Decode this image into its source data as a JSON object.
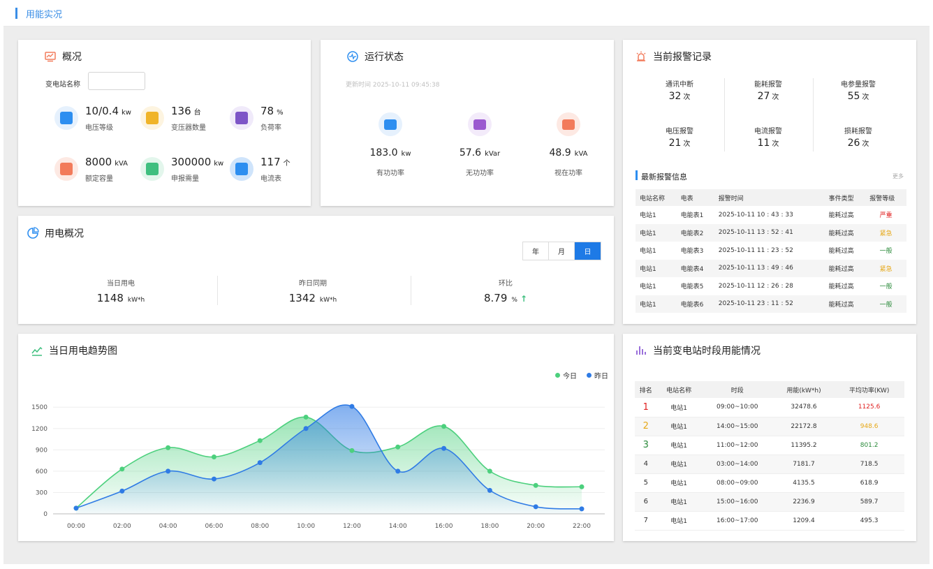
{
  "header": {
    "title": "用能实况"
  },
  "overview": {
    "title": "概况",
    "station_label": "变电站名称",
    "station_value": "",
    "metrics": [
      {
        "value": "10/0.4",
        "unit": "kw",
        "label": "电压等级",
        "icon": "gauge-icon",
        "color": "#2d8ef0",
        "bg": "#e6f1fd"
      },
      {
        "value": "136",
        "unit": "台",
        "label": "变压器数量",
        "icon": "transformer-icon",
        "color": "#f0b429",
        "bg": "#fdf4e0"
      },
      {
        "value": "78",
        "unit": "%",
        "label": "负荷率",
        "icon": "load-chart-icon",
        "color": "#7d55c7",
        "bg": "#f0eafa"
      },
      {
        "value": "8000",
        "unit": "kVA",
        "label": "额定容量",
        "icon": "capacity-icon",
        "color": "#f27b5b",
        "bg": "#fde9e3"
      },
      {
        "value": "300000",
        "unit": "kw",
        "label": "申报需量",
        "icon": "document-icon",
        "color": "#3fbf7f",
        "bg": "#e3f6ec"
      },
      {
        "value": "117",
        "unit": "个",
        "label": "电流表",
        "icon": "ammeter-icon",
        "color": "#2d8ef0",
        "bg": "#cfe4fb"
      }
    ]
  },
  "running": {
    "title": "运行状态",
    "update_time": "更新时间 2025-10-11 09:45:38",
    "items": [
      {
        "value": "183.0",
        "unit": "kw",
        "label": "有功功率",
        "icon": "wave-icon",
        "color": "#2d8ef0",
        "bg": "#e6f1fd"
      },
      {
        "value": "57.6",
        "unit": "kVar",
        "label": "无功功率",
        "icon": "q-icon",
        "color": "#9b59d0",
        "bg": "#f3ebfa"
      },
      {
        "value": "48.9",
        "unit": "kVA",
        "label": "视在功率",
        "icon": "bar-icon",
        "color": "#f27b5b",
        "bg": "#fde9e3"
      }
    ]
  },
  "alarm": {
    "title": "当前报警记录",
    "stats": [
      {
        "label": "通讯中断",
        "value": "32",
        "unit": "次"
      },
      {
        "label": "能耗报警",
        "value": "27",
        "unit": "次"
      },
      {
        "label": "电参量报警",
        "value": "55",
        "unit": "次"
      },
      {
        "label": "电压报警",
        "value": "21",
        "unit": "次"
      },
      {
        "label": "电流报警",
        "value": "11",
        "unit": "次"
      },
      {
        "label": "损耗报警",
        "value": "26",
        "unit": "次"
      }
    ],
    "latest_title": "最新报警信息",
    "more": "更多",
    "columns": [
      "电站名称",
      "电表",
      "报警时间",
      "事件类型",
      "报警等级"
    ],
    "rows": [
      {
        "station": "电站1",
        "meter": "电能表1",
        "time": "2025-10-11 10 : 43 : 33",
        "type": "能耗过高",
        "level": "严重",
        "color": "#e02020"
      },
      {
        "station": "电站1",
        "meter": "电能表2",
        "time": "2025-10-11 13 : 52 : 41",
        "type": "能耗过高",
        "level": "紧急",
        "color": "#e6a817"
      },
      {
        "station": "电站1",
        "meter": "电能表3",
        "time": "2025-10-11 11 : 23 : 52",
        "type": "能耗过高",
        "level": "一般",
        "color": "#2a8a3a"
      },
      {
        "station": "电站1",
        "meter": "电能表4",
        "time": "2025-10-11 13 : 49 : 46",
        "type": "能耗过高",
        "level": "紧急",
        "color": "#e6a817"
      },
      {
        "station": "电站1",
        "meter": "电能表5",
        "time": "2025-10-11 12 : 26 : 28",
        "type": "能耗过高",
        "level": "一般",
        "color": "#2a8a3a"
      },
      {
        "station": "电站1",
        "meter": "电能表6",
        "time": "2025-10-11 23 : 11 : 52",
        "type": "能耗过高",
        "level": "一般",
        "color": "#2a8a3a"
      }
    ]
  },
  "usage": {
    "title": "用电概况",
    "tabs": [
      "年",
      "月",
      "日"
    ],
    "active_tab": 2,
    "items": [
      {
        "label": "当日用电",
        "value": "1148",
        "unit": "kW*h"
      },
      {
        "label": "昨日同期",
        "value": "1342",
        "unit": "kW*h"
      },
      {
        "label": "环比",
        "value": "8.79",
        "unit": "%",
        "trend": "↑"
      }
    ]
  },
  "trend": {
    "title": "当日用电趋势图",
    "legend": [
      {
        "name": "今日",
        "color": "#4cd07d"
      },
      {
        "name": "昨日",
        "color": "#2f7be5"
      }
    ]
  },
  "chart_data": {
    "type": "area",
    "x": [
      "00:00",
      "02:00",
      "04:00",
      "06:00",
      "08:00",
      "10:00",
      "12:00",
      "14:00",
      "16:00",
      "18:00",
      "20:00",
      "22:00"
    ],
    "yticks": [
      0,
      300,
      600,
      900,
      1200,
      1500
    ],
    "ylim": [
      0,
      1600
    ],
    "grid": true,
    "legend_position": "top-right",
    "series": [
      {
        "name": "今日",
        "color": "#4cd07d",
        "values": [
          80,
          630,
          930,
          800,
          1030,
          1360,
          890,
          940,
          1230,
          600,
          400,
          380
        ]
      },
      {
        "name": "昨日",
        "color": "#2f7be5",
        "values": [
          80,
          320,
          600,
          490,
          720,
          1200,
          1510,
          600,
          920,
          330,
          100,
          70
        ]
      }
    ]
  },
  "ranking": {
    "title": "当前变电站时段用能情况",
    "columns": [
      "排名",
      "电站名称",
      "时段",
      "用能(kW*h)",
      "平均功率(KW)"
    ],
    "rows": [
      {
        "rank": "1",
        "station": "电站1",
        "period": "09:00~10:00",
        "energy": "32478.6",
        "power": "1125.6",
        "color": "#e02020"
      },
      {
        "rank": "2",
        "station": "电站1",
        "period": "14:00~15:00",
        "energy": "22172.8",
        "power": "948.6",
        "color": "#e6a817"
      },
      {
        "rank": "3",
        "station": "电站1",
        "period": "11:00~12:00",
        "energy": "11395.2",
        "power": "801.2",
        "color": "#2a8a3a"
      },
      {
        "rank": "4",
        "station": "电站1",
        "period": "03:00~14:00",
        "energy": "7181.7",
        "power": "718.5",
        "color": "#333333"
      },
      {
        "rank": "5",
        "station": "电站1",
        "period": "08:00~09:00",
        "energy": "4135.5",
        "power": "618.9",
        "color": "#333333"
      },
      {
        "rank": "6",
        "station": "电站1",
        "period": "15:00~16:00",
        "energy": "2236.9",
        "power": "589.7",
        "color": "#333333"
      },
      {
        "rank": "7",
        "station": "电站1",
        "period": "16:00~17:00",
        "energy": "1209.4",
        "power": "495.3",
        "color": "#333333"
      }
    ]
  }
}
